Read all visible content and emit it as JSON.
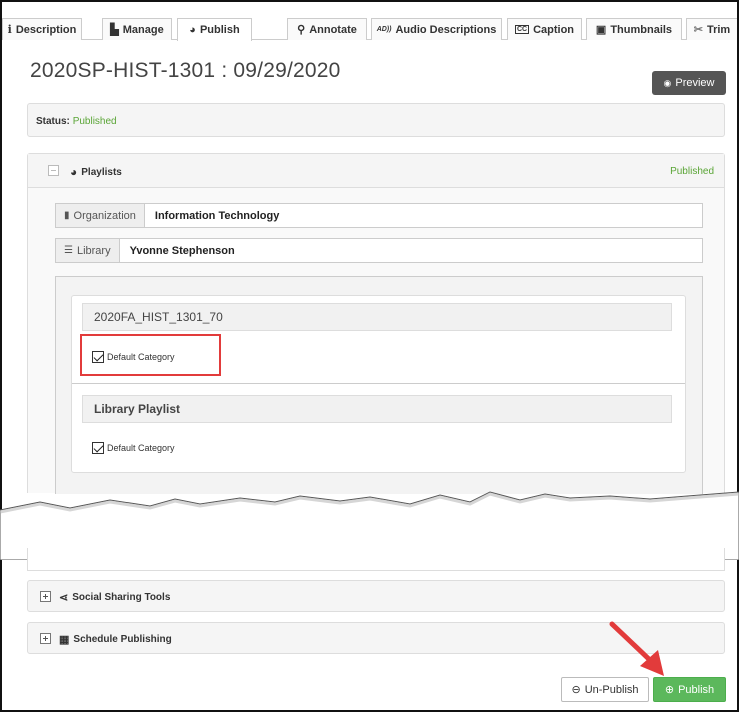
{
  "tabs": [
    {
      "label": "Description",
      "icon": "info-icon",
      "glyph": "i"
    },
    {
      "label": "Manage",
      "icon": "file-icon",
      "glyph": "▙"
    },
    {
      "label": "Publish",
      "icon": "globe-icon",
      "glyph": "◕"
    },
    {
      "label": "Annotate",
      "icon": "search-icon",
      "glyph": "🔍︎"
    },
    {
      "label": "Audio Descriptions",
      "icon": "audio-description-icon",
      "glyph": "AD"
    },
    {
      "label": "Caption",
      "icon": "cc-icon",
      "glyph": "CC"
    },
    {
      "label": "Thumbnails",
      "icon": "image-icon",
      "glyph": "▣"
    },
    {
      "label": "Trim",
      "icon": "scissors-icon",
      "glyph": "✂"
    }
  ],
  "page": {
    "title": "2020SP-HIST-1301 : 09/29/2020",
    "preview_label": "Preview",
    "preview_glyph": "👁︎"
  },
  "status": {
    "label": "Status:",
    "value": "Published"
  },
  "playlists": {
    "title": "Playlists",
    "status": "Published",
    "organization_label": "Organization",
    "organization_value": "Information Technology",
    "library_label": "Library",
    "library_value": "Yvonne Stephenson",
    "items": [
      {
        "name": "2020FA_HIST_1301_70",
        "category": "Default Category"
      },
      {
        "name": "Library Playlist",
        "category": "Default Category"
      }
    ]
  },
  "sections": {
    "social": "Social Sharing Tools",
    "schedule": "Schedule Publishing"
  },
  "buttons": {
    "unpublish": "Un-Publish",
    "publish": "Publish"
  },
  "colors": {
    "published_green": "#5aa536",
    "publish_button": "#5cb85c",
    "highlight_red": "#e23b3b"
  }
}
